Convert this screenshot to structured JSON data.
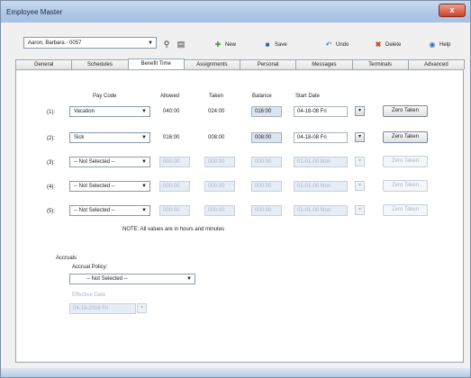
{
  "window": {
    "title": "Employee Master",
    "close_glyph": "x"
  },
  "toolbar": {
    "employee": "Aaron, Barbara - 0057",
    "new_label": "New",
    "save_label": "Save",
    "undo_label": "Undo",
    "delete_label": "Delete",
    "help_label": "Help"
  },
  "tabs": [
    "General",
    "Schedules",
    "Benefit Time",
    "Assignments",
    "Personal",
    "Messages",
    "Terminals",
    "Advanced"
  ],
  "active_tab": "Benefit Time",
  "headers": {
    "pay_code": "Pay Code",
    "allowed": "Allowed",
    "taken": "Taken",
    "balance": "Balance",
    "start_date": "Start Date"
  },
  "rows": [
    {
      "index": "(1):",
      "pay_code": "Vacation",
      "allowed": "040:00",
      "taken": "024:00",
      "balance": "016:00",
      "start_date": "04-18-08 Fri",
      "zero": "Zero Taken",
      "enabled": true
    },
    {
      "index": "(2):",
      "pay_code": "Sick",
      "allowed": "016:00",
      "taken": "008:00",
      "balance": "008:00",
      "start_date": "04-18-08 Fri",
      "zero": "Zero Taken",
      "enabled": true
    },
    {
      "index": "(3):",
      "pay_code": "-- Not Selected --",
      "allowed": "000:00",
      "taken": "000:00",
      "balance": "000:00",
      "start_date": "01-01-00 Mon",
      "zero": "Zero Taken",
      "enabled": false
    },
    {
      "index": "(4):",
      "pay_code": "-- Not Selected --",
      "allowed": "000:00",
      "taken": "000:00",
      "balance": "000:00",
      "start_date": "01-01-00 Mon",
      "zero": "Zero Taken",
      "enabled": false
    },
    {
      "index": "(5):",
      "pay_code": "-- Not Selected --",
      "allowed": "000:00",
      "taken": "000:00",
      "balance": "000:00",
      "start_date": "01-01-00 Mon",
      "zero": "Zero Taken",
      "enabled": false
    }
  ],
  "note": "NOTE: All values are in hours and minutes",
  "accruals": {
    "section": "Accruals",
    "policy_label": "Accrual Policy:",
    "policy_value": "-- Not Selected --",
    "effective_label": "Effective Date",
    "effective_value": "04-18-2008 Fri"
  }
}
